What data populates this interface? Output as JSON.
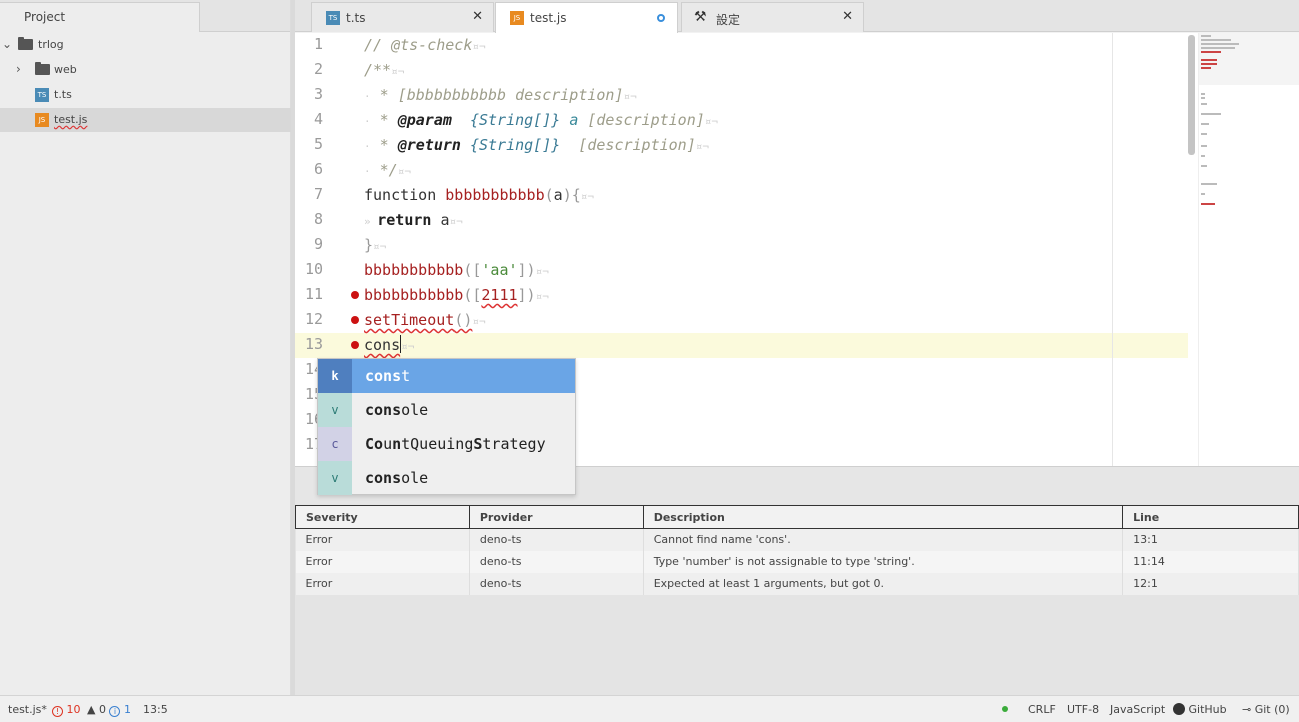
{
  "tree": {
    "tab_label": "Project",
    "items": [
      {
        "label": "trlog",
        "icon": "folder-icon"
      },
      {
        "label": "web",
        "icon": "folder-icon"
      },
      {
        "label": "t.ts",
        "icon": "ts-file-icon",
        "badge": "TS"
      },
      {
        "label": "test.js",
        "icon": "js-file-icon",
        "badge": "JS"
      }
    ]
  },
  "tabs": [
    {
      "label": "t.ts",
      "badge": "TS"
    },
    {
      "label": "test.js",
      "badge": "JS"
    },
    {
      "label": "設定"
    }
  ],
  "editor": {
    "line_numbers": [
      "1",
      "2",
      "3",
      "4",
      "5",
      "6",
      "7",
      "8",
      "9",
      "10",
      "11",
      "12",
      "13",
      "14",
      "15",
      "16",
      "17"
    ]
  },
  "autocomplete": {
    "items": [
      {
        "kind": "k",
        "match": "cons",
        "rest": "t"
      },
      {
        "kind": "v",
        "match": "cons",
        "rest": "ole"
      },
      {
        "kind": "c",
        "text": "CountQueuingStrategy"
      },
      {
        "kind": "v",
        "match": "cons",
        "rest": "ole"
      }
    ]
  },
  "diagnostics": {
    "headers": [
      "Severity",
      "Provider",
      "Description",
      "Line"
    ],
    "rows": [
      [
        "Error",
        "deno-ts",
        "Cannot find name 'cons'.",
        "13:1"
      ],
      [
        "Error",
        "deno-ts",
        "Type 'number' is not assignable to type 'string'.",
        "11:14"
      ],
      [
        "Error",
        "deno-ts",
        "Expected at least 1 arguments, but got 0.",
        "12:1"
      ]
    ]
  },
  "status": {
    "file": "test.js*",
    "errors": "10",
    "warnings": "0",
    "infos": "1",
    "cursor": "13:5",
    "line_ending": "CRLF",
    "encoding": "UTF-8",
    "grammar": "JavaScript",
    "github": "GitHub",
    "git": "Git (0)"
  },
  "colors": {
    "error_red": "#cc1111",
    "autocomplete_selected": "#6aa5e6",
    "current_line": "#fbfadc"
  }
}
